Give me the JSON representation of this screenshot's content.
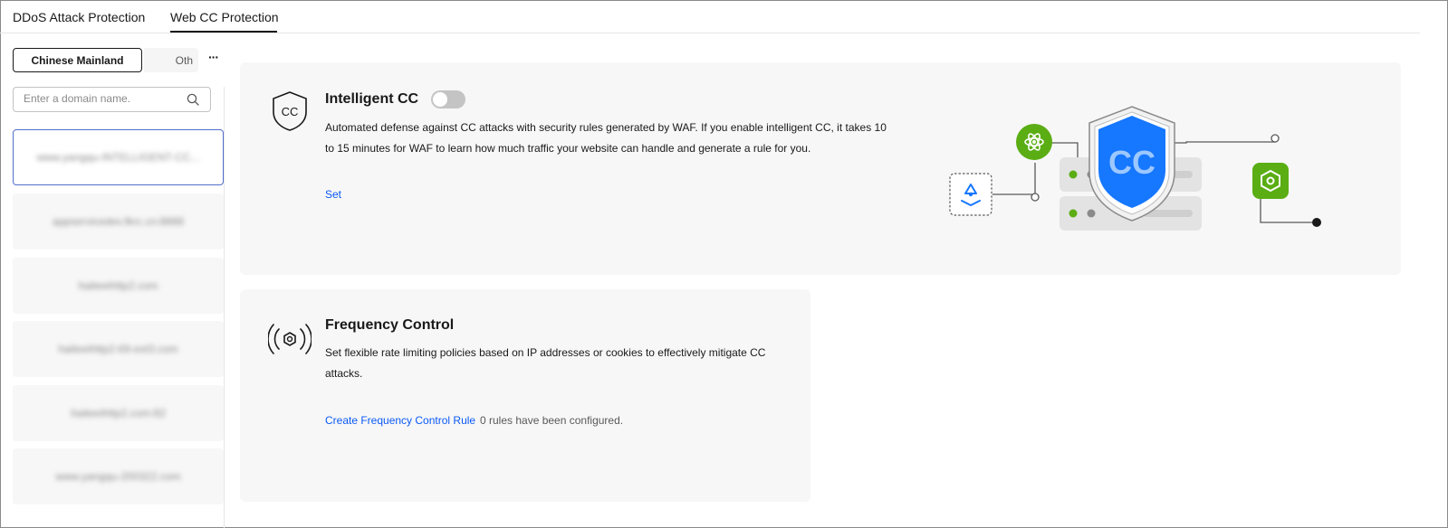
{
  "tabs": [
    {
      "label": "DDoS Attack Protection"
    },
    {
      "label": "Web CC Protection"
    }
  ],
  "region": {
    "selected": "Chinese Mainland",
    "other": "Oth"
  },
  "search": {
    "placeholder": "Enter a domain name.",
    "value": ""
  },
  "domains": [
    {
      "name": "www.yangqu-INTELLIGENT-CC..."
    },
    {
      "name": "appservicedev.fkrc.cn:8888"
    },
    {
      "name": "haiteeihttp2.com"
    },
    {
      "name": "haiteeihttp2-t0t-ext3.com"
    },
    {
      "name": "haiteeihttp2.com:82"
    },
    {
      "name": "www.yangqu-200322.com"
    }
  ],
  "intelligent_cc": {
    "title": "Intelligent CC",
    "description_line1": "Automated defense against CC attacks with security rules generated by WAF. If you enable intelligent CC, it takes 10",
    "description_line2": "to 15 minutes for WAF to learn how much traffic your website can handle and generate a rule for you.",
    "set_label": "Set",
    "enabled": false,
    "shield_text": "CC"
  },
  "frequency_control": {
    "title": "Frequency Control",
    "description_line1": "Set flexible rate limiting policies based on IP addresses or cookies to effectively mitigate CC",
    "description_line2": "attacks.",
    "create_label": "Create Frequency Control Rule",
    "rules_status": "0 rules have been configured."
  },
  "colors": {
    "accent": "#0a59f7",
    "shield_blue": "#1677ff",
    "green": "#5aad13"
  }
}
